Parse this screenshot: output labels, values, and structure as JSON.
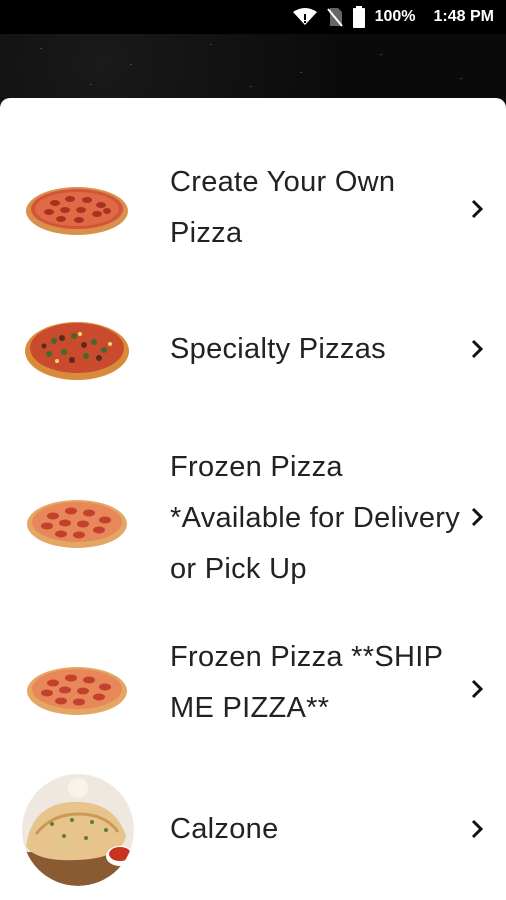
{
  "status": {
    "battery": "100%",
    "time": "1:48 PM"
  },
  "menu": {
    "items": [
      {
        "label": "Create Your Own Pizza",
        "icon": "pepperoni-pizza-icon"
      },
      {
        "label": "Specialty Pizzas",
        "icon": "supreme-pizza-icon"
      },
      {
        "label": "Frozen Pizza *Available for Delivery or Pick Up",
        "icon": "frozen-pizza-icon"
      },
      {
        "label": "Frozen Pizza **SHIP ME PIZZA**",
        "icon": "frozen-pizza-ship-icon"
      },
      {
        "label": "Calzone",
        "icon": "calzone-icon"
      }
    ]
  },
  "colors": {
    "sheet_background": "#ffffff",
    "text": "#222222",
    "crust": "#e0a15a",
    "sauce": "#d2553a",
    "pepperoni": "#b3382a"
  }
}
